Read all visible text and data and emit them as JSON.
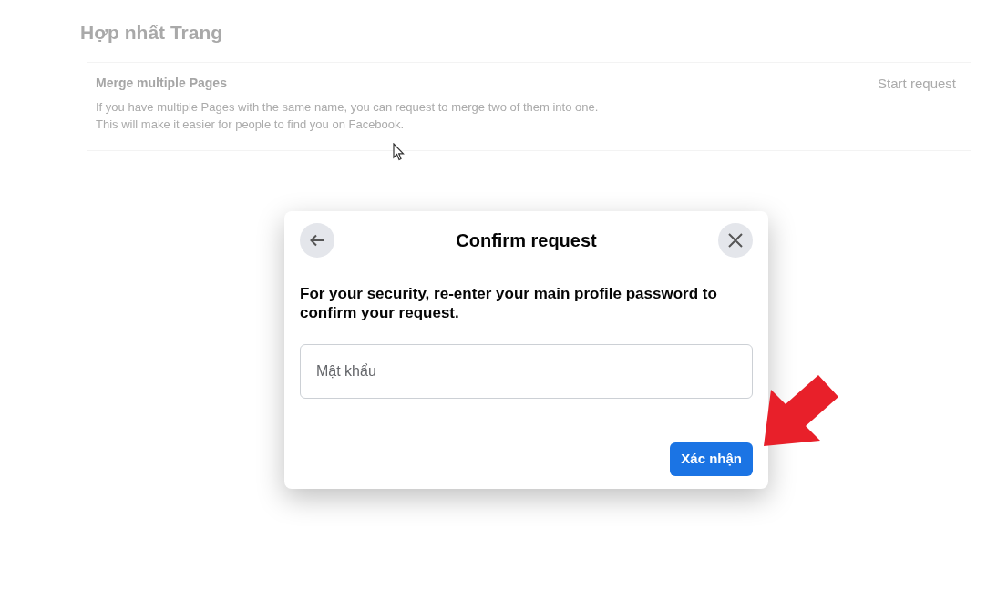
{
  "page": {
    "title": "Hợp nhất Trang",
    "card": {
      "heading": "Merge multiple Pages",
      "action": "Start request",
      "lines": [
        "If you have multiple Pages with the same name, you can request to merge two of them into one.",
        "This will make it easier for people to find you on Facebook."
      ]
    }
  },
  "dialog": {
    "title": "Confirm request",
    "message": "For your security, re-enter your main profile password to confirm your request.",
    "password": {
      "placeholder": "Mật khẩu"
    },
    "confirm": "Xác nhận"
  }
}
